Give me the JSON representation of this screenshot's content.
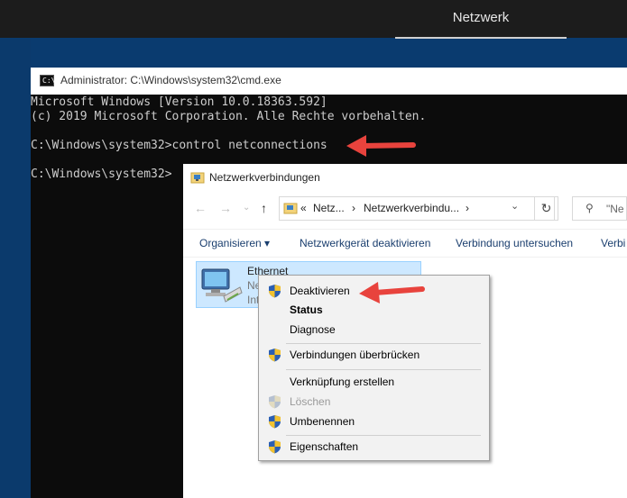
{
  "topbar": {
    "tab_label": "Netzwerk"
  },
  "cmd": {
    "title": "Administrator: C:\\Windows\\system32\\cmd.exe",
    "lines": [
      "Microsoft Windows [Version 10.0.18363.592]",
      "(c) 2019 Microsoft Corporation. Alle Rechte vorbehalten.",
      "C:\\Windows\\system32>control netconnections",
      "C:\\Windows\\system32>"
    ]
  },
  "explorer": {
    "title": "Netzwerkverbindungen",
    "address": {
      "prefix": "«",
      "crumb1": "Netz...",
      "sep": "›",
      "crumb2": "Netzwerkverbindu...",
      "sep2": "›",
      "dropdown": "⌄"
    },
    "search_placeholder": "\"Ne",
    "toolbar": {
      "organize": "Organisieren ▾",
      "disable": "Netzwerkgerät deaktivieren",
      "diagnose": "Verbindung untersuchen",
      "more": "Verbi"
    },
    "connection": {
      "name": "Ethernet",
      "line2": "Ne",
      "line3": "Int"
    }
  },
  "context_menu": {
    "items": [
      {
        "label": "Deaktivieren",
        "shield": true,
        "style": "normal"
      },
      {
        "label": "Status",
        "shield": false,
        "style": "bold"
      },
      {
        "label": "Diagnose",
        "shield": false,
        "style": "normal"
      },
      {
        "label": "Verbindungen überbrücken",
        "shield": true,
        "style": "normal"
      },
      {
        "label": "Verknüpfung erstellen",
        "shield": false,
        "style": "normal"
      },
      {
        "label": "Löschen",
        "shield": true,
        "style": "disabled"
      },
      {
        "label": "Umbenennen",
        "shield": true,
        "style": "normal"
      },
      {
        "label": "Eigenschaften",
        "shield": true,
        "style": "normal"
      }
    ]
  },
  "colors": {
    "arrow": "#e8433d",
    "desktop": "#0a3b6f",
    "selection": "#cde8ff"
  }
}
